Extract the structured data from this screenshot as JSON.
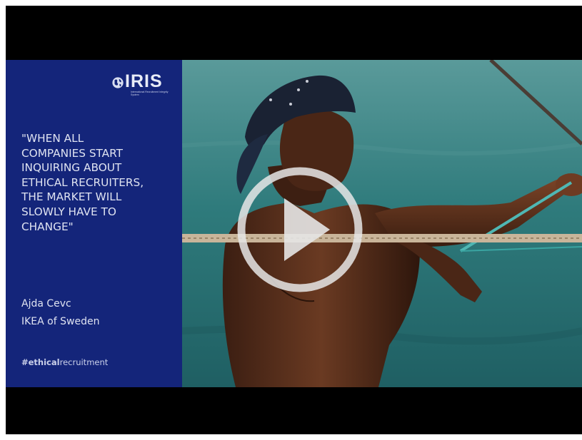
{
  "video": {
    "logo_text": "IRIS",
    "logo_subtitle": "International Recruitment Integrity System",
    "quote": "\"WHEN ALL\nCOMPANIES START\nINQUIRING ABOUT\nETHICAL RECRUITERS,\nTHE MARKET WILL\nSLOWLY HAVE TO\nCHANGE\"",
    "author": "Ajda Cevc",
    "organization": "IKEA of Sweden",
    "hashtag_bold": "#ethical",
    "hashtag_rest": "recruitment",
    "play_icon": "play-icon",
    "globe_icon": "globe-icon"
  },
  "colors": {
    "panel": "#14257a",
    "letterbox": "#000000",
    "sea": "#2f7f7f",
    "play_overlay": "#e6e6e6"
  }
}
